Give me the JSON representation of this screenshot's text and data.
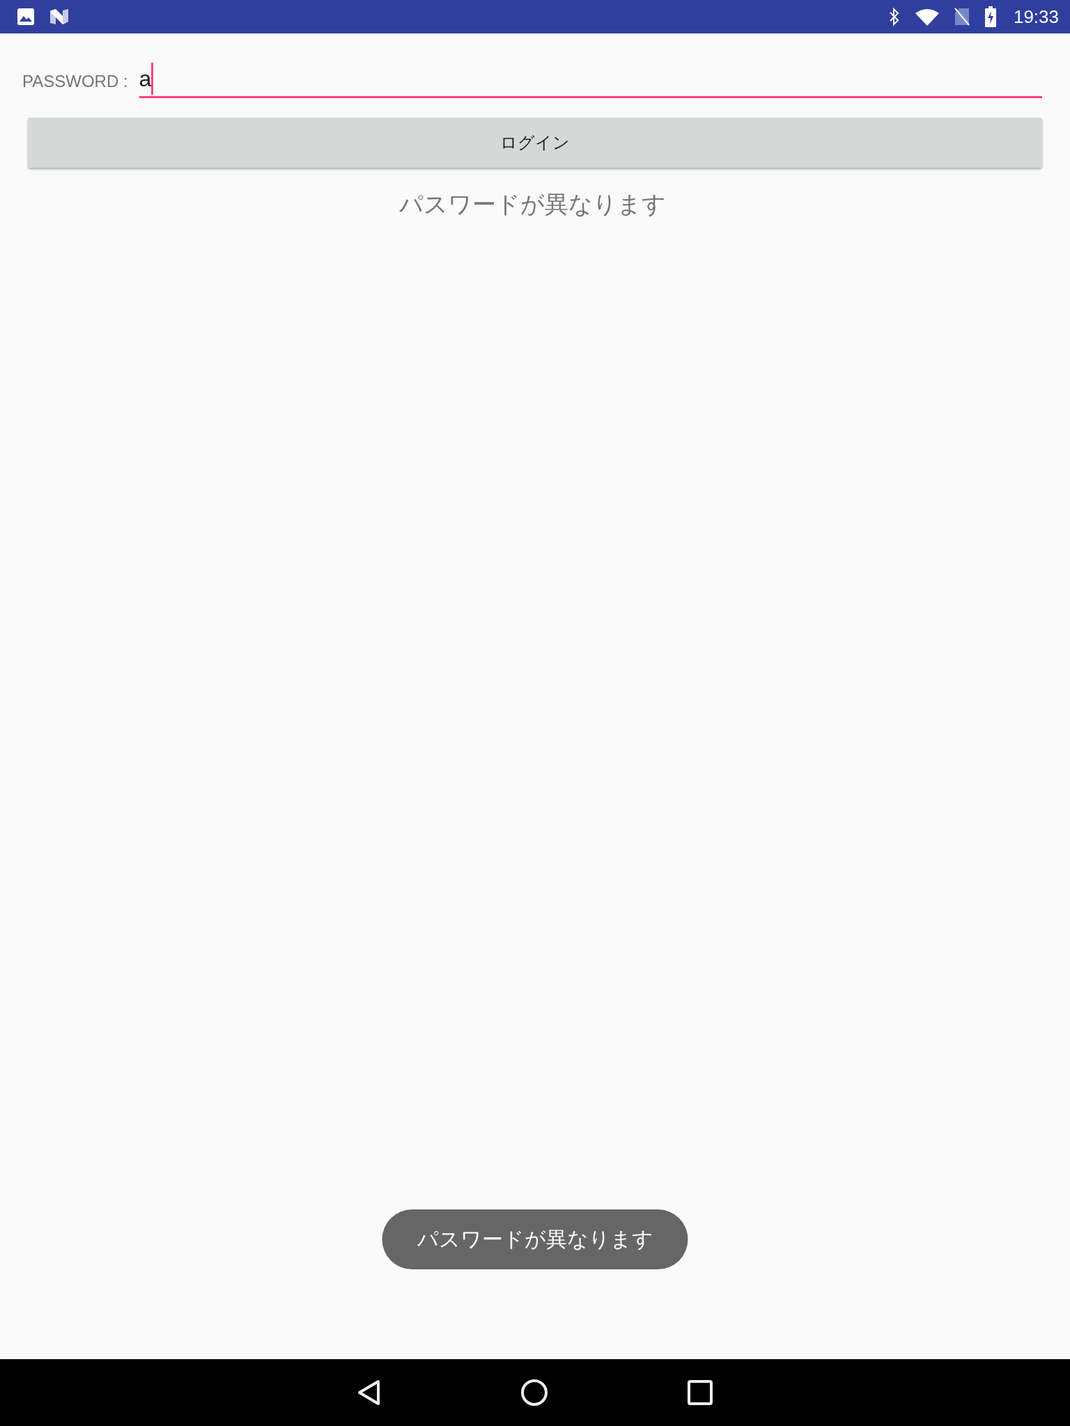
{
  "status_bar": {
    "time": "19:33"
  },
  "password_field": {
    "label": "PASSWORD :",
    "value": "a",
    "focused": true
  },
  "login_button": {
    "label": "ログイン"
  },
  "message": "パスワードが異なります",
  "toast": "パスワードが異なります"
}
